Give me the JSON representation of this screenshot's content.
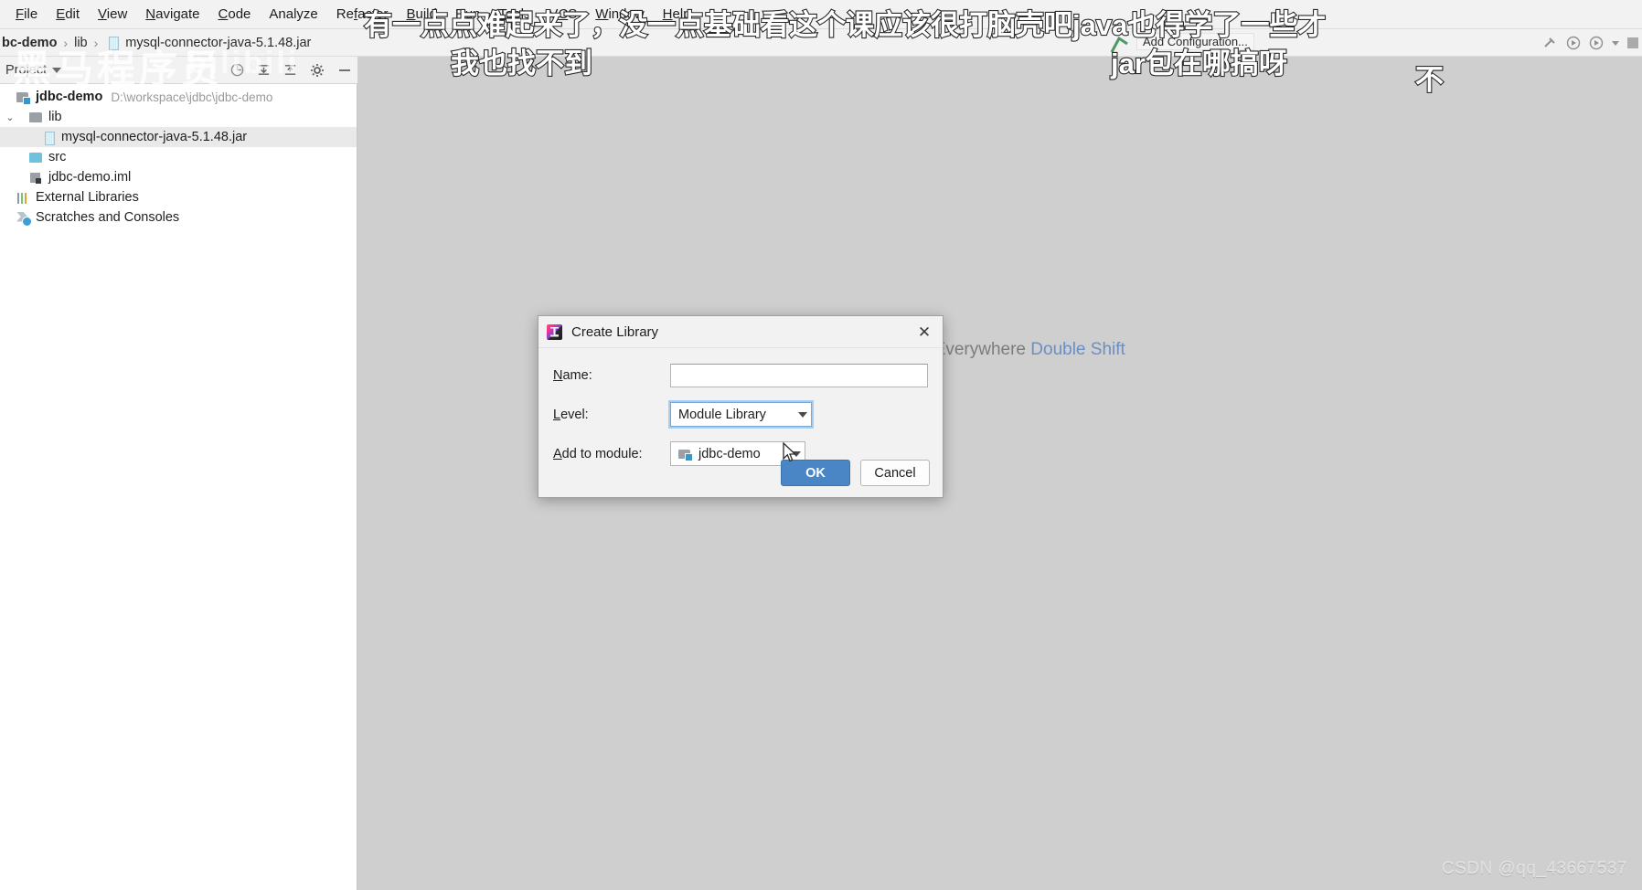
{
  "menubar": {
    "items": [
      {
        "label": "File",
        "mnemonic": "F"
      },
      {
        "label": "Edit",
        "mnemonic": "E"
      },
      {
        "label": "View",
        "mnemonic": "V"
      },
      {
        "label": "Navigate",
        "mnemonic": "N"
      },
      {
        "label": "Code",
        "mnemonic": "C"
      },
      {
        "label": "Analyze",
        "mnemonic": "A"
      },
      {
        "label": "Refactor",
        "mnemonic": "R"
      },
      {
        "label": "Build",
        "mnemonic": "B"
      },
      {
        "label": "Run",
        "mnemonic": "R"
      },
      {
        "label": "Tools",
        "mnemonic": "T"
      },
      {
        "label": "VCS",
        "mnemonic": "V"
      },
      {
        "label": "Window",
        "mnemonic": "W"
      },
      {
        "label": "Help",
        "mnemonic": "H"
      }
    ]
  },
  "breadcrumb": {
    "items": [
      "bc-demo",
      "lib",
      "mysql-connector-java-5.1.48.jar"
    ],
    "separator": "›"
  },
  "toolbar": {
    "add_configuration": "Add Configuration..."
  },
  "tool_window": {
    "title": "Project"
  },
  "project_tree": [
    {
      "label": "jdbc-demo",
      "path": "D:\\workspace\\jdbc\\jdbc-demo",
      "icon": "module-icon",
      "indent": 0,
      "bold": true,
      "twisty": "",
      "selected": false
    },
    {
      "label": "lib",
      "path": "",
      "icon": "folder-icon",
      "indent": 1,
      "bold": false,
      "twisty": "⌄",
      "selected": false
    },
    {
      "label": "mysql-connector-java-5.1.48.jar",
      "path": "",
      "icon": "jar-icon",
      "indent": 2,
      "bold": false,
      "twisty": "",
      "selected": true
    },
    {
      "label": "src",
      "path": "",
      "icon": "source-folder-icon",
      "indent": 1,
      "bold": false,
      "twisty": "",
      "selected": false
    },
    {
      "label": "jdbc-demo.iml",
      "path": "",
      "icon": "iml-file-icon",
      "indent": 1,
      "bold": false,
      "twisty": "",
      "selected": false
    },
    {
      "label": "External Libraries",
      "path": "",
      "icon": "external-libraries-icon",
      "indent": 0,
      "bold": false,
      "twisty": "",
      "selected": false
    },
    {
      "label": "Scratches and Consoles",
      "path": "",
      "icon": "scratches-icon",
      "indent": 0,
      "bold": false,
      "twisty": "",
      "selected": false
    }
  ],
  "editor": {
    "search_hint_text": "Search Everywhere ",
    "search_hint_shortcut": "Double Shift"
  },
  "dialog": {
    "title": "Create Library",
    "name_label": "Name:",
    "name_mnemonic": "N",
    "name_value": "",
    "level_label": "Level:",
    "level_mnemonic": "L",
    "level_value": "Module Library",
    "module_label": "Add to module:",
    "module_mnemonic": "A",
    "module_value": "jdbc-demo",
    "ok_label": "OK",
    "cancel_label": "Cancel",
    "close_glyph": "✕",
    "accent_ok": "#4a86c5",
    "focus_ring": "#a9cdee"
  },
  "overlay_comments": [
    "有一点点难起来了，没一点基础看这个课应该很打脑壳吧java也得学了一些才",
    "我也找不到",
    "jar包在哪搞呀",
    "不"
  ],
  "watermark": {
    "logo": "黑马程序员",
    "platform": "bilibili",
    "csdn": "CSDN @qq_43667537"
  }
}
